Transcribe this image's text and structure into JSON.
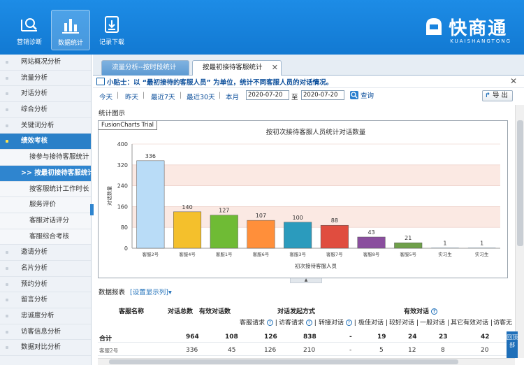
{
  "header": {
    "nav": [
      {
        "label": "营销诊断",
        "icon": "diagnosis-icon"
      },
      {
        "label": "数据统计",
        "icon": "bar-chart-icon"
      },
      {
        "label": "记录下载",
        "icon": "download-icon"
      }
    ],
    "brand_name": "快商通",
    "brand_sub": "KUAISHANGTONG"
  },
  "sidebar": {
    "items": [
      {
        "label": "网站概况分析",
        "kind": "item"
      },
      {
        "label": "流量分析",
        "kind": "item"
      },
      {
        "label": "对话分析",
        "kind": "item"
      },
      {
        "label": "综合分析",
        "kind": "item"
      },
      {
        "label": "关键词分析",
        "kind": "item"
      },
      {
        "label": "绩效考核",
        "kind": "section"
      },
      {
        "label": "接参与接待客服统计",
        "kind": "sub"
      },
      {
        "label": ">> 按最初接待客服统计",
        "kind": "active"
      },
      {
        "label": "按客服统计工作时长",
        "kind": "sub"
      },
      {
        "label": "服务评价",
        "kind": "sub"
      },
      {
        "label": "客服对话评分",
        "kind": "sub"
      },
      {
        "label": "客服综合考核",
        "kind": "sub"
      },
      {
        "label": "邀请分析",
        "kind": "item"
      },
      {
        "label": "名片分析",
        "kind": "item"
      },
      {
        "label": "预约分析",
        "kind": "item"
      },
      {
        "label": "留言分析",
        "kind": "item"
      },
      {
        "label": "忠诚度分析",
        "kind": "item"
      },
      {
        "label": "访客信息分析",
        "kind": "item"
      },
      {
        "label": "数据对比分析",
        "kind": "item"
      }
    ]
  },
  "tabs": [
    {
      "label": "流量分析--按时段统计"
    },
    {
      "label": "按最初接待客服统计",
      "close": "✕"
    }
  ],
  "tip": {
    "text": "小贴士：以 “最初接待的客服人员” 为单位，统计不同客服人员的对话情况。",
    "close": "✕"
  },
  "filters": {
    "quick": [
      "今天",
      "昨天",
      "最近7天",
      "最近30天",
      "本月"
    ],
    "separator": "|",
    "date_from": "2020-07-20",
    "to_label": "至",
    "date_to": "2020-07-20",
    "query_label": "查询",
    "export_label": "导 出",
    "export_arrow": "↱"
  },
  "section_title": "统计图示",
  "chart_data": {
    "type": "bar",
    "title": "按初次接待客服人员统计对话数量",
    "xlabel": "初次接待客服人员",
    "ylabel": "对话数量",
    "ylim": [
      0,
      400
    ],
    "yticks": [
      "0",
      "80",
      "160",
      "240",
      "320",
      "400"
    ],
    "categories": [
      "客服2号",
      "客服4号",
      "客服1号",
      "客服6号",
      "客服3号",
      "客服7号",
      "客服8号",
      "客服5号",
      "实习生",
      "实习生"
    ],
    "values": [
      336,
      140,
      127,
      107,
      100,
      88,
      43,
      21,
      1,
      1
    ],
    "colors": [
      "#b9dcf7",
      "#f4c02c",
      "#6fbb35",
      "#ff8f3a",
      "#2b9bbd",
      "#e04d3f",
      "#8a4e9e",
      "#6fa04a",
      "#9aa7b2",
      "#9aa7b2"
    ],
    "watermark": "FusionCharts Trial"
  },
  "collapse_glyph": "▲",
  "report": {
    "title": "数据报表",
    "settings_link": "[设置显示列]",
    "settings_arrow": "▾",
    "headers": {
      "name": "客服名称",
      "total": "对话总数",
      "effective": "有效对话数",
      "initiator_group": "对话发起方式",
      "effective_group": "有效对话",
      "help": "?",
      "sub": [
        "客服请求",
        "访客请求",
        "转接对话",
        "极佳对话",
        "较好对话",
        "一般对话",
        "其它有效对话",
        "访客无"
      ]
    },
    "rows": [
      {
        "name": "合计",
        "total": "964",
        "effective": "108",
        "c1": "126",
        "c2": "838",
        "c3": "-",
        "c4": "19",
        "c5": "24",
        "c6": "23",
        "c7": "42"
      },
      {
        "name": "客服2号",
        "total": "336",
        "effective": "45",
        "c1": "126",
        "c2": "210",
        "c3": "-",
        "c4": "5",
        "c5": "12",
        "c6": "8",
        "c7": "20"
      }
    ]
  },
  "back_top": "回顶部"
}
